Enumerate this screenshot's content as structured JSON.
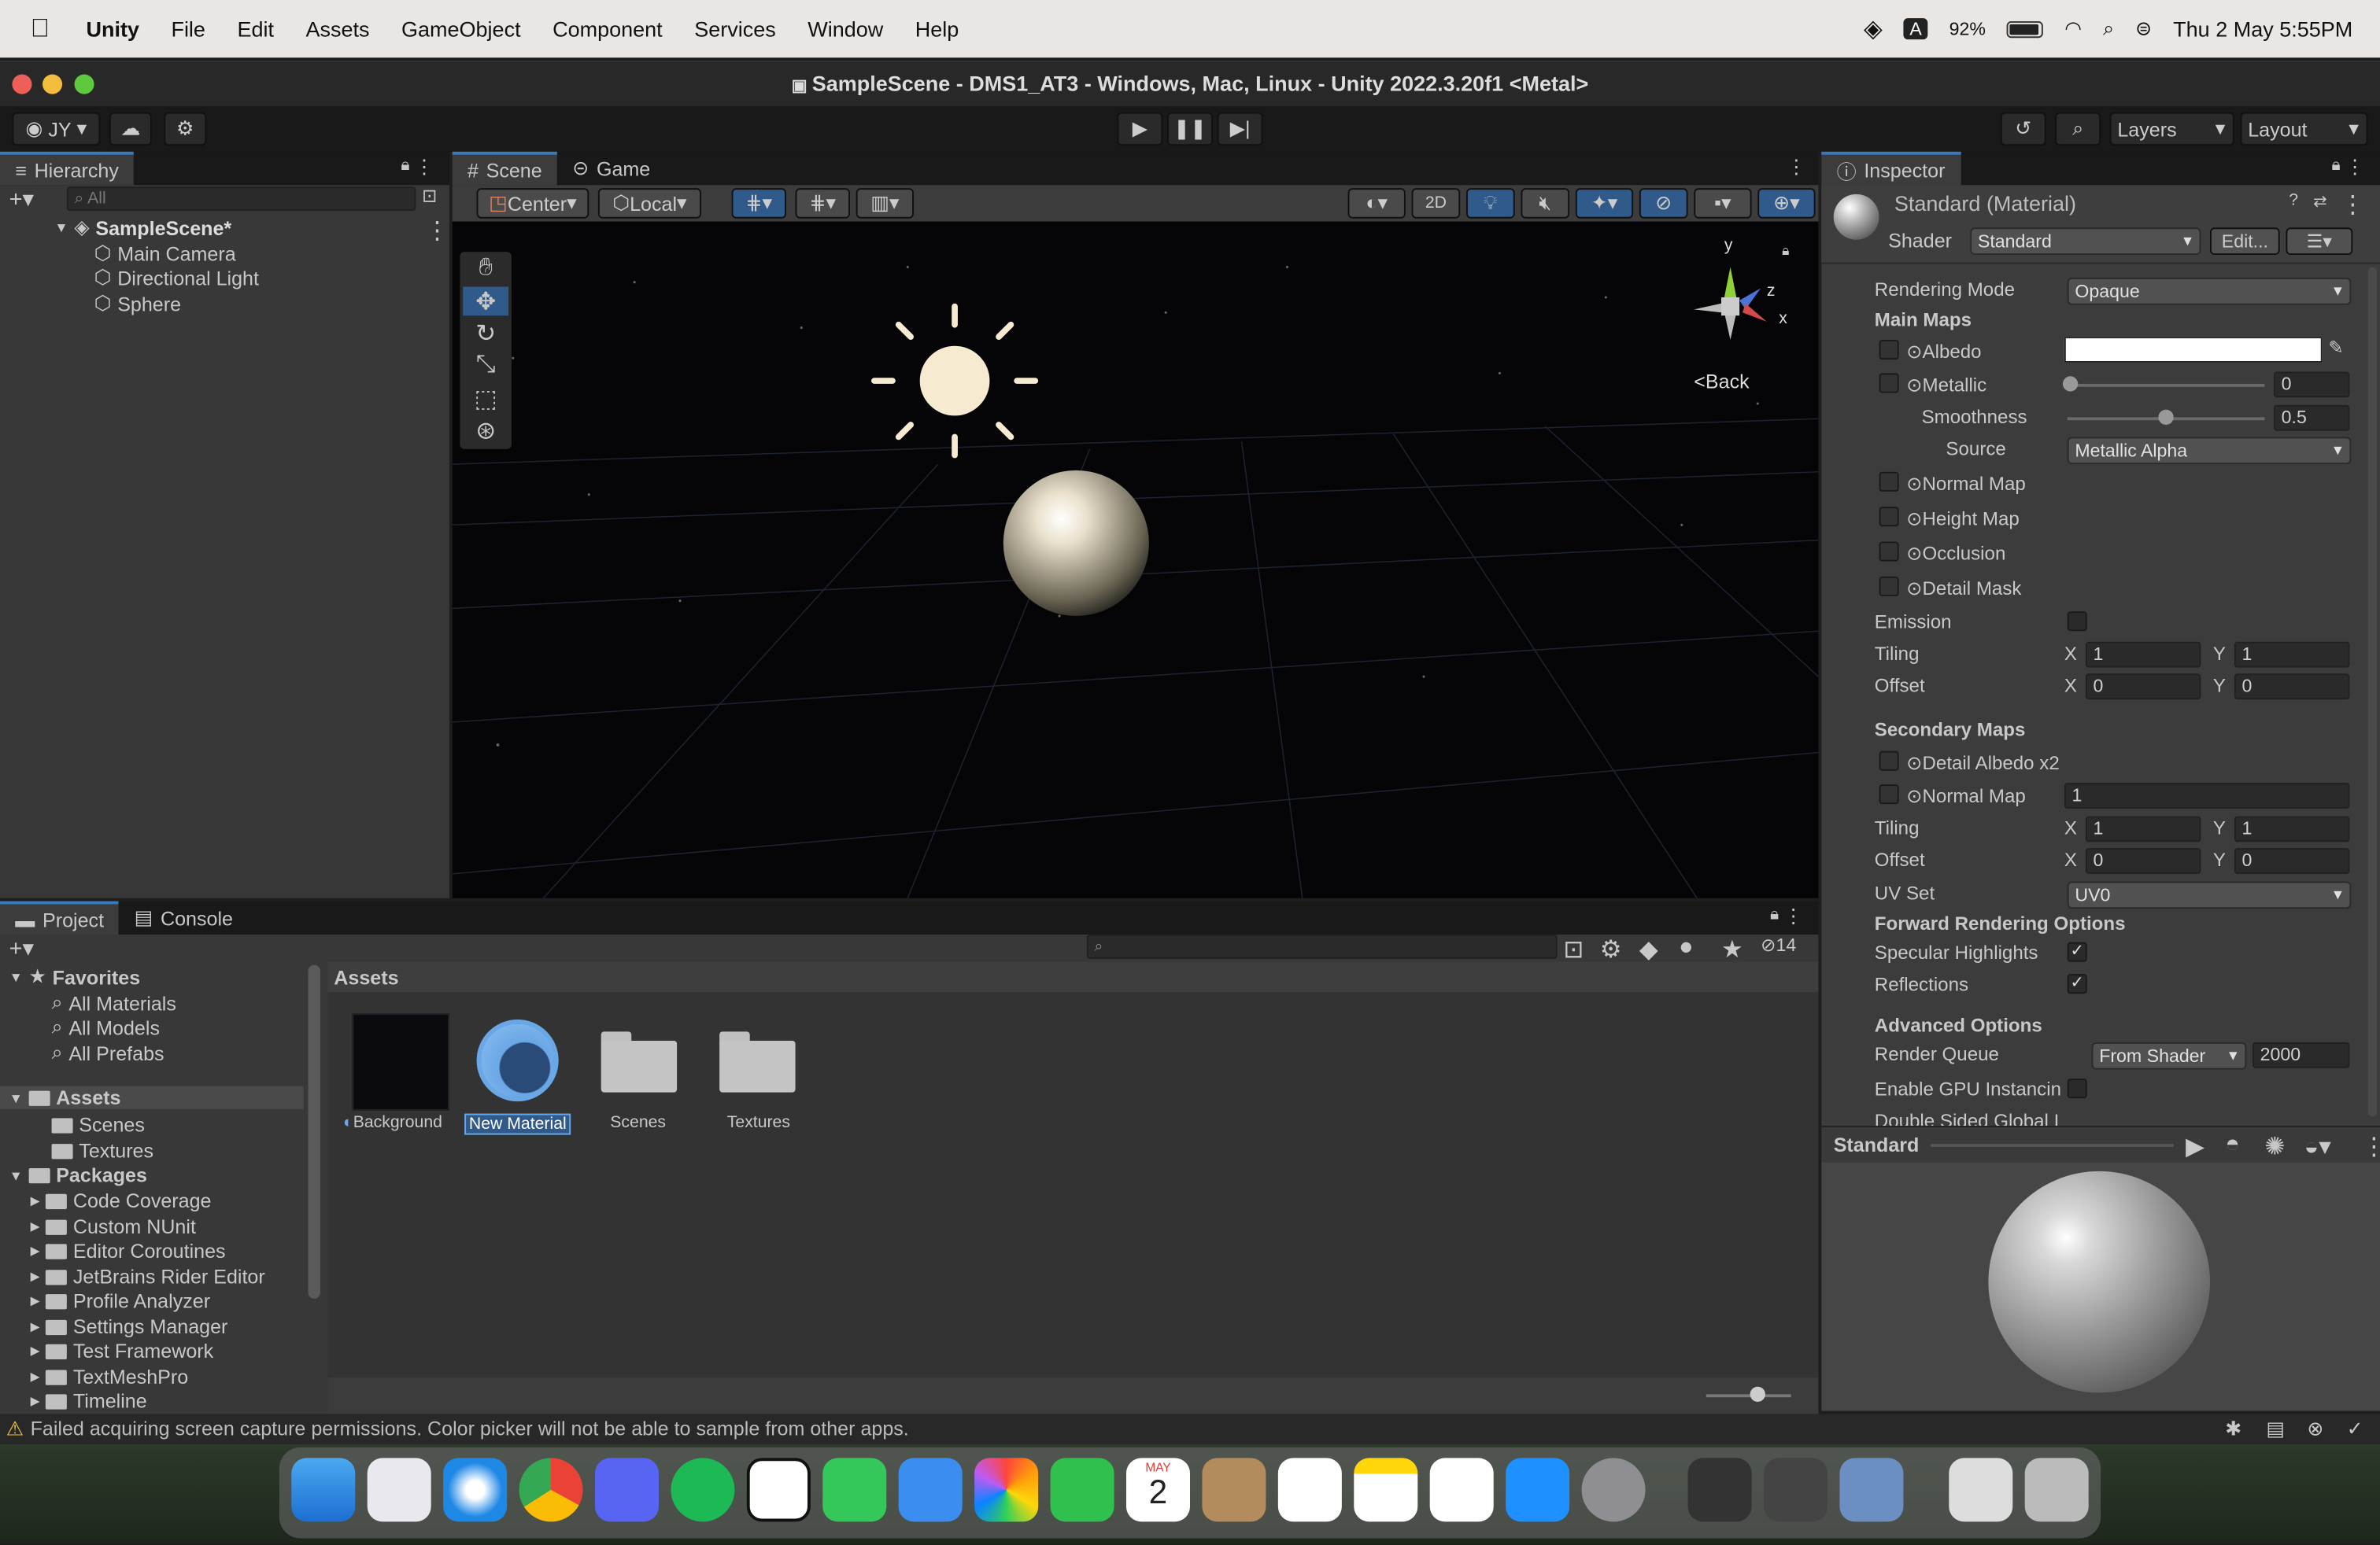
{
  "menubar": {
    "app": "Unity",
    "items": [
      "File",
      "Edit",
      "Assets",
      "GameObject",
      "Component",
      "Services",
      "Window",
      "Help"
    ],
    "battery": "92%",
    "datetime": "Thu 2 May  5:55PM",
    "input_badge": "A"
  },
  "window": {
    "title": "SampleScene - DMS1_AT3 - Windows, Mac, Linux - Unity 2022.3.20f1 <Metal>"
  },
  "toolbar": {
    "account": "JY",
    "layers": "Layers",
    "layout": "Layout"
  },
  "hierarchy": {
    "tab": "Hierarchy",
    "search_placeholder": "All",
    "scene": "SampleScene*",
    "objects": [
      "Main Camera",
      "Directional Light",
      "Sphere"
    ]
  },
  "scene_view": {
    "tabs": [
      "Scene",
      "Game"
    ],
    "pivot": "Center",
    "space": "Local",
    "mode_2d": "2D",
    "gizmo_back": "Back",
    "axis_y": "y",
    "axis_z": "z",
    "axis_x": "x"
  },
  "project": {
    "tabs": [
      "Project",
      "Console"
    ],
    "favorites_label": "Favorites",
    "favorites": [
      "All Materials",
      "All Models",
      "All Prefabs"
    ],
    "assets_label": "Assets",
    "asset_folders": [
      "Scenes",
      "Textures"
    ],
    "packages_label": "Packages",
    "packages": [
      "Code Coverage",
      "Custom NUnit",
      "Editor Coroutines",
      "JetBrains Rider Editor",
      "Profile Analyzer",
      "Settings Manager",
      "Test Framework",
      "TextMeshPro",
      "Timeline"
    ],
    "breadcrumb": "Assets",
    "hidden_count": "14",
    "items": [
      {
        "label": "Background",
        "kind": "material-dark"
      },
      {
        "label": "New Material",
        "kind": "material-selected"
      },
      {
        "label": "Scenes",
        "kind": "folder"
      },
      {
        "label": "Textures",
        "kind": "folder"
      }
    ]
  },
  "inspector": {
    "tab": "Inspector",
    "material_name": "Standard (Material)",
    "shader_label": "Shader",
    "shader_value": "Standard",
    "edit_button": "Edit...",
    "rendering_mode_label": "Rendering Mode",
    "rendering_mode_value": "Opaque",
    "main_maps": "Main Maps",
    "albedo": "Albedo",
    "metallic": "Metallic",
    "metallic_value": "0",
    "smoothness": "Smoothness",
    "smoothness_value": "0.5",
    "source_label": "Source",
    "source_value": "Metallic Alpha",
    "normal_map": "Normal Map",
    "height_map": "Height Map",
    "occlusion": "Occlusion",
    "detail_mask": "Detail Mask",
    "emission": "Emission",
    "tiling": "Tiling",
    "offset": "Offset",
    "x": "X",
    "y": "Y",
    "tiling_x": "1",
    "tiling_y": "1",
    "offset_x": "0",
    "offset_y": "0",
    "secondary_maps": "Secondary Maps",
    "detail_albedo": "Detail Albedo x2",
    "normal_map2": "Normal Map",
    "normal_map2_value": "1",
    "tiling2_x": "1",
    "tiling2_y": "1",
    "offset2_x": "0",
    "offset2_y": "0",
    "uv_set_label": "UV Set",
    "uv_set_value": "UV0",
    "forward_rendering": "Forward Rendering Options",
    "specular": "Specular Highlights",
    "reflections": "Reflections",
    "advanced": "Advanced Options",
    "render_queue_label": "Render Queue",
    "render_queue_mode": "From Shader",
    "render_queue_value": "2000",
    "gpu_instancing": "Enable GPU Instancin",
    "double_sided": "Double Sided Global I",
    "preview_label": "Standard"
  },
  "status": {
    "message": "Failed acquiring screen capture permissions. Color picker will not be able to sample from other apps."
  },
  "dock": {
    "calendar_month": "MAY",
    "calendar_day": "2"
  }
}
